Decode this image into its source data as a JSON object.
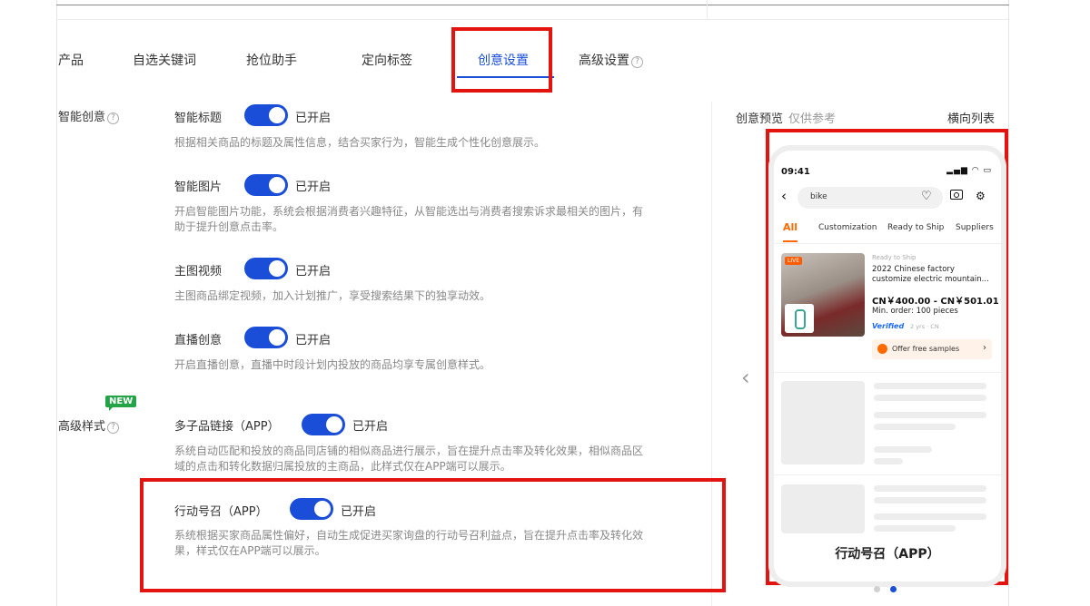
{
  "tabs": [
    {
      "label": "产品"
    },
    {
      "label": "自选关键词"
    },
    {
      "label": "抢位助手"
    },
    {
      "label": "定向标签"
    },
    {
      "label": "创意设置",
      "active": true
    },
    {
      "label": "高级设置"
    }
  ],
  "sections": {
    "smart_creative": {
      "label": "智能创意"
    },
    "advanced_style": {
      "label": "高级样式",
      "badge": "NEW"
    }
  },
  "options": [
    {
      "title": "智能标题",
      "status": "已开启",
      "enabled": true,
      "desc": [
        "根据相关商品的标题及属性信息，结合买家行为，智能生成个性化创意展示。"
      ]
    },
    {
      "title": "智能图片",
      "status": "已开启",
      "enabled": true,
      "desc": [
        "开启智能图片功能，系统会根据消费者兴趣特征，从智能选出与消费者搜索诉求最相关的图片，有",
        "助于提升创意点击率。"
      ]
    },
    {
      "title": "主图视频",
      "status": "已开启",
      "enabled": true,
      "desc": [
        "主图商品绑定视频，加入计划推广，享受搜索结果下的独享动效。"
      ]
    },
    {
      "title": "直播创意",
      "status": "已开启",
      "enabled": true,
      "desc": [
        "开启直播创意，直播中时段计划内投放的商品均享专属创意样式。"
      ]
    },
    {
      "title": "多子品链接（APP）",
      "status": "已开启",
      "enabled": true,
      "desc": [
        "系统自动匹配和投放的商品同店铺的相似商品进行展示，旨在提升点击率及转化效果，相似商品区",
        "域的点击和转化数据归属投放的主商品，此样式仅在APP端可以展示。"
      ]
    },
    {
      "title": "行动号召（APP）",
      "status": "已开启",
      "enabled": true,
      "desc": [
        "系统根据买家商品属性偏好，自动生成促进买家询盘的行动号召利益点，旨在提升点击率及转化效",
        "果，样式仅在APP端可以展示。"
      ]
    }
  ],
  "preview": {
    "title": "创意预览",
    "note": "仅供参考",
    "layout_link": "横向列表",
    "caption": "行动号召（APP）",
    "page_index": 2,
    "page_count": 2,
    "phone": {
      "time": "09:41",
      "search_text": "bike",
      "tabs": [
        "All",
        "Customization",
        "Ready to Ship",
        "Suppliers"
      ],
      "product": {
        "live_tag": "LIVE",
        "ready_tag": "Ready to Ship",
        "title": "2022 Chinese factory customize electric mountain...",
        "price": "CN￥400.00 - CN￥501.01",
        "moq": "Min. order: 100 pieces",
        "verified": "Verified",
        "supplier_meta": "2 yrs · CN",
        "cta": "Offer free samples"
      }
    }
  },
  "colors": {
    "accent": "#1a4ed8",
    "highlight": "#e3140f",
    "cta": "#ff6a00",
    "new_badge": "#22a447"
  }
}
